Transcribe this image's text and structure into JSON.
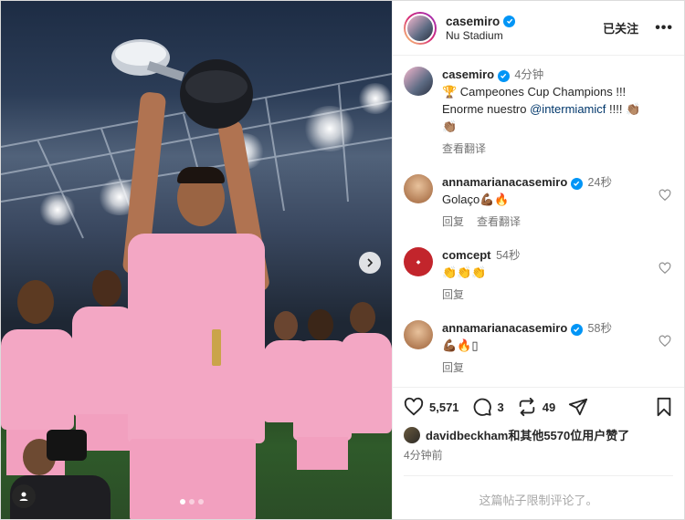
{
  "header": {
    "username": "casemiro",
    "location": "Nu Stadium",
    "follow_label": "已关注",
    "more_label": "•••"
  },
  "caption": {
    "username": "casemiro",
    "time": "4分钟",
    "line1": "🏆 Campeones Cup Champions !!!",
    "line2_prefix": "Enorme nuestro ",
    "mention": "@intermiamicf",
    "line2_suffix": " !!!! 👏🏽",
    "line3": "👏🏽",
    "translate_label": "查看翻译"
  },
  "comments": [
    {
      "username": "annamarianacasemiro",
      "time": "24秒",
      "text": "Golaço💪🏾🔥",
      "reply_label": "回复",
      "translate_label": "查看翻译",
      "avatar_color": "#c59b76"
    },
    {
      "username": "comcept",
      "time": "54秒",
      "text": "👏👏👏",
      "reply_label": "回复",
      "avatar_color": "#c2252c"
    },
    {
      "username": "annamarianacasemiro",
      "time": "58秒",
      "text": "💪🏾🔥▯",
      "reply_label": "回复",
      "avatar_color": "#c59b76"
    }
  ],
  "stats": {
    "likes": "5,571",
    "comments": "3",
    "reposts": "49"
  },
  "liked_by": "davidbeckham和其他5570位用户赞了",
  "posted_ago": "4分钟前",
  "restricted_note": "这篇帖子限制评论了。",
  "colors": {
    "verified": "#0095f6",
    "jersey_pink": "#f3a7c4",
    "mention": "#00376b"
  }
}
